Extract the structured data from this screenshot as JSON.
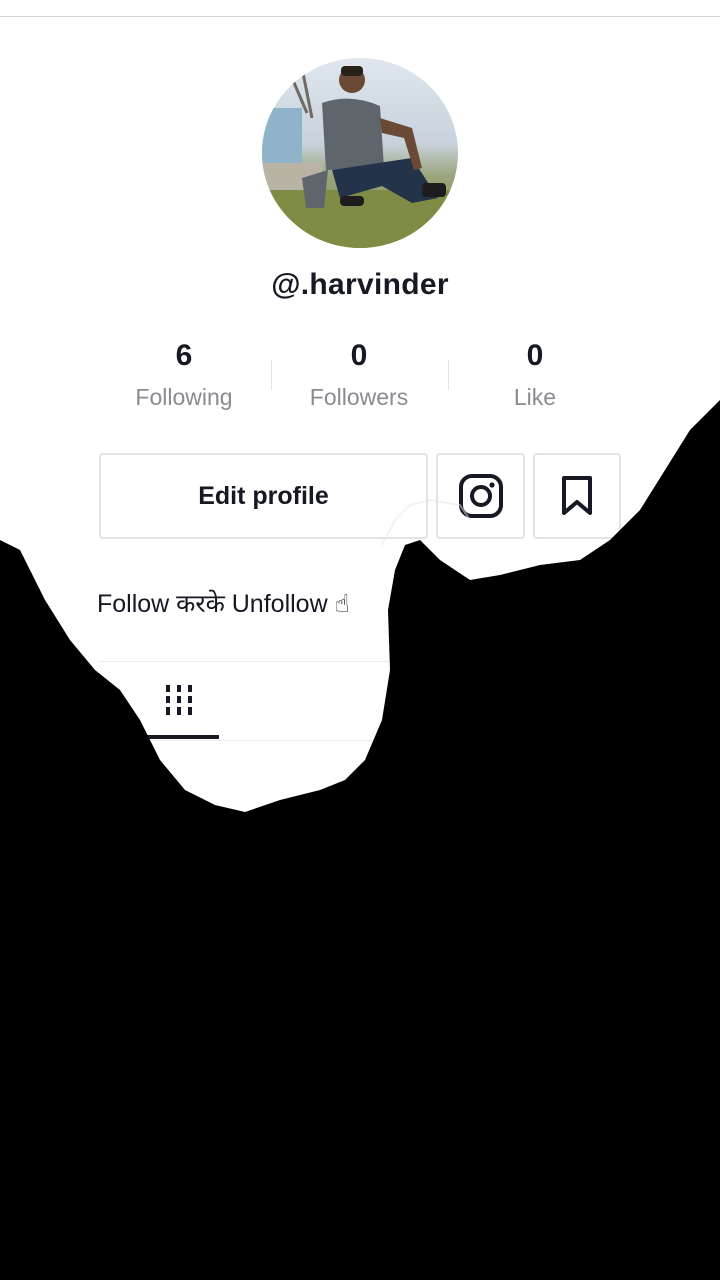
{
  "profile": {
    "username": "@.harvinder",
    "bio": "Follow करके Unfollow ☝"
  },
  "stats": [
    {
      "value": "6",
      "label": "Following"
    },
    {
      "value": "0",
      "label": "Followers"
    },
    {
      "value": "0",
      "label": "Like"
    }
  ],
  "actions": {
    "edit_profile": "Edit profile"
  },
  "icons": {
    "instagram": "instagram-icon",
    "bookmark": "bookmark-icon",
    "videos_tab": "grid-icon"
  },
  "colors": {
    "text": "#161823",
    "muted": "#8a8b91",
    "border": "#e3e3e4",
    "overlay": "#000000"
  }
}
